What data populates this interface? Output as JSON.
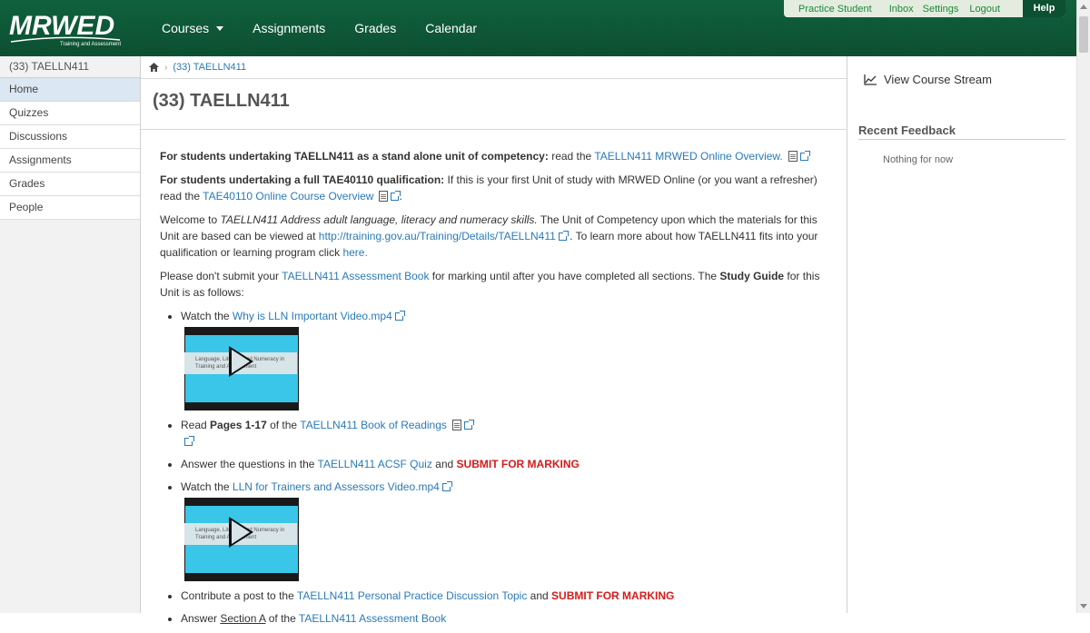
{
  "header": {
    "logo_text": "MRWED",
    "logo_tagline": "Training and Assessment",
    "nav": [
      "Courses",
      "Assignments",
      "Grades",
      "Calendar"
    ],
    "toplinks": [
      "Practice Student",
      "Inbox",
      "Settings",
      "Logout"
    ],
    "help": "Help"
  },
  "leftnav": {
    "course_title": "(33) TAELLN411",
    "items": [
      "Home",
      "Quizzes",
      "Discussions",
      "Assignments",
      "Grades",
      "People"
    ]
  },
  "breadcrumb": {
    "current": "(33) TAELLN411"
  },
  "page_title": "(33) TAELLN411",
  "content": {
    "p1_bold": "For students undertaking TAELLN411 as a stand alone unit of competency:",
    "p1_text": " read the ",
    "p1_link": "TAELLN411 MRWED Online Overview.",
    "p2_bold": "For students undertaking a full TAE40110 qualification:",
    "p2_text": " If this is your first Unit of study with MRWED Online (or you want a refresher) read the ",
    "p2_link": "TAE40110 Online Course Overview",
    "p2_end": ".",
    "p3_a": "Welcome to ",
    "p3_em": "TAELLN411 Address adult language, literacy and numeracy skills.",
    "p3_b": " The Unit of Competency upon which the materials for this Unit are based can be viewed at ",
    "p3_link": "http://training.gov.au/Training/Details/TAELLN411",
    "p3_c": " .  To learn more about how TAELLN411 fits into your qualification or learning program click ",
    "p3_link2": "here.",
    "p4_a": "Please don't submit your ",
    "p4_link": "TAELLN411 Assessment Book",
    "p4_b": " for marking until after you have completed all sections. The ",
    "p4_bold": "Study Guide",
    "p4_c": " for this Unit is as follows:",
    "video_caption": "Language, Literacy and Numeracy in Training and Assessment",
    "li1_a": "Watch the ",
    "li1_link": "Why is LLN Important Video.mp4",
    "li2_a": "Read ",
    "li2_bold": "Pages 1-17",
    "li2_b": " of the ",
    "li2_link": "TAELLN411 Book of Readings",
    "li3_a": "Answer the questions in the ",
    "li3_link": "TAELLN411 ACSF Quiz",
    "li3_b": " and ",
    "li3_red": "SUBMIT FOR MARKING",
    "li4_a": "Watch the ",
    "li4_link": "LLN for Trainers and Assessors Video.mp4",
    "li5_a": "Contribute a post to the ",
    "li5_link": "TAELLN411 Personal Practice Discussion Topic",
    "li5_b": " and ",
    "li5_red": "SUBMIT FOR MARKING",
    "li6_a": "Answer ",
    "li6_u": "Section A",
    "li6_b": " of the ",
    "li6_link": "TAELLN411 Assessment Book"
  },
  "rightcol": {
    "stream_label": "View Course Stream",
    "feedback_header": "Recent Feedback",
    "feedback_empty": "Nothing for now"
  }
}
